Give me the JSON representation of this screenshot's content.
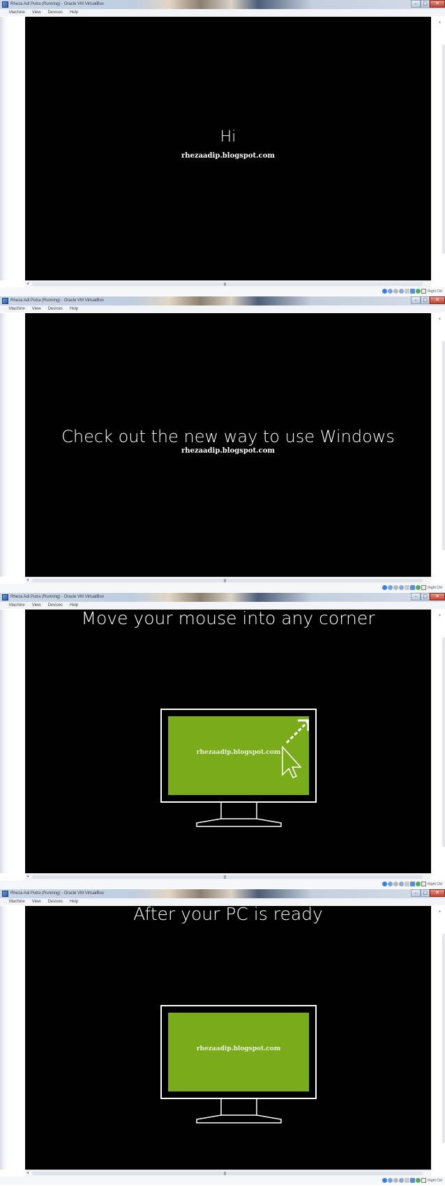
{
  "window": {
    "title": "Rheza Adi Putra (Running) - Oracle VM VirtualBox",
    "minimize_glyph": "–",
    "maximize_glyph": "□",
    "close_glyph": "✕"
  },
  "menu": [
    "Machine",
    "View",
    "Devices",
    "Help"
  ],
  "status": {
    "host_key": "Right Ctrl"
  },
  "frames": [
    {
      "heading": "Hi",
      "watermark": "rhezaadip.blogspot.com",
      "monitor": false
    },
    {
      "heading": "Check out the new way to use Windows",
      "watermark": "rhezaadip.blogspot.com",
      "monitor": false
    },
    {
      "heading": "Move your mouse into any corner",
      "watermark": "rhezaadip.blogspot.com",
      "monitor": true,
      "arrow_cursor": true
    },
    {
      "heading": "After your PC is ready",
      "watermark": "rhezaadip.blogspot.com",
      "monitor": true,
      "arrow_cursor": false
    }
  ],
  "colors": {
    "screen_bg": "#000000",
    "monitor_green": "#7aab1a",
    "text": "#ffffff"
  },
  "icons": [
    "app-icon",
    "cd-icon",
    "network-icon",
    "usb-icon",
    "shared-folder-icon",
    "capture-icon",
    "mouse-icon",
    "keyboard-icon"
  ]
}
